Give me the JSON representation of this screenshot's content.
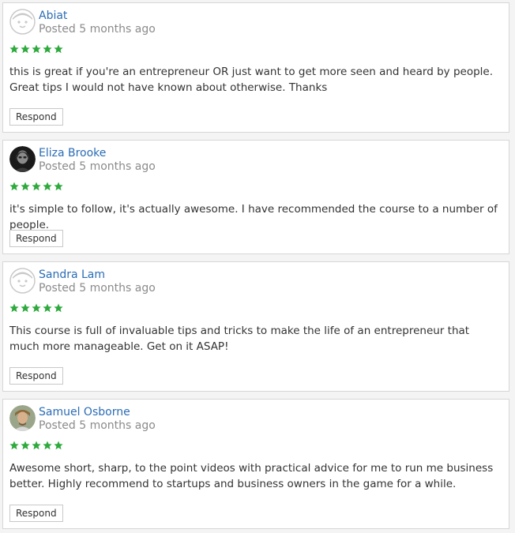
{
  "accent_color": "#2b6cb5",
  "star_color": "#2eaa3d",
  "reviews": [
    {
      "name": "Abiat",
      "posted": "Posted 5 months ago",
      "rating": 5,
      "avatar_icon": "default-avatar-face-icon",
      "text": "this is great if you're an entrepreneur OR just want to get more seen and heard by people. Great tips I would not have known about otherwise. Thanks",
      "respond_label": "Respond"
    },
    {
      "name": "Eliza Brooke",
      "posted": "Posted 5 months ago",
      "rating": 5,
      "avatar_icon": "user-photo-avatar",
      "text": "it's simple to follow, it's actually awesome. I have recommended the course to a number of people.",
      "respond_label": "Respond"
    },
    {
      "name": "Sandra Lam",
      "posted": "Posted 5 months ago",
      "rating": 5,
      "avatar_icon": "default-avatar-face-icon",
      "text": "This course is full of invaluable tips and tricks to make the life of an entrepreneur that much more manageable. Get on it ASAP!",
      "respond_label": "Respond"
    },
    {
      "name": "Samuel Osborne",
      "posted": "Posted 5 months ago",
      "rating": 5,
      "avatar_icon": "user-photo-avatar",
      "text": "Awesome short, sharp, to the point videos with practical advice for me to run me business better. Highly recommend to startups and business owners in the game for a while.",
      "respond_label": "Respond"
    }
  ]
}
